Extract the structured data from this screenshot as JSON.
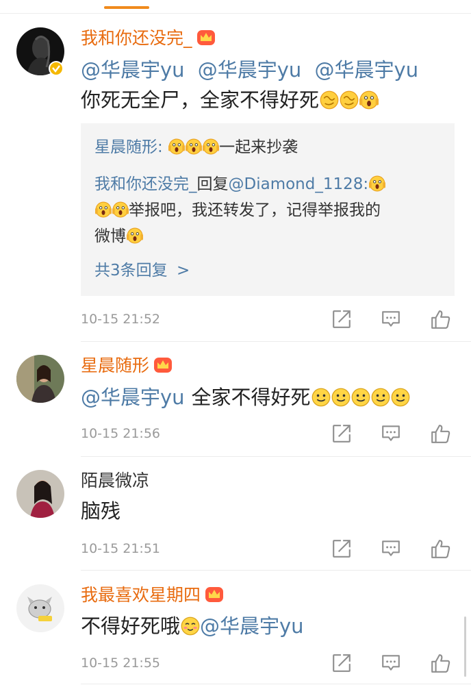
{
  "comments": [
    {
      "username": "我和你还没完_",
      "mentions": [
        "@华晨宇yu",
        "@华晨宇yu",
        "@华晨宇yu"
      ],
      "text": "你死无全尸，全家不得好死",
      "replies": {
        "r1_user": "星晨随形:",
        "r1_text": "一起来抄袭",
        "r2_user": "我和你还没完_",
        "r2_verb": "回复",
        "r2_mention": "@Diamond_1128:",
        "r2_text_a": "举报吧，我还转发了，记得举报我的",
        "r2_text_b": "微博",
        "more": "共3条回复",
        "more_chevron": ">"
      },
      "time": "10-15 21:52"
    },
    {
      "username": "星晨随形",
      "mention": "@华晨宇yu",
      "text": "全家不得好死",
      "time": "10-15 21:56"
    },
    {
      "username": "陌晨微凉",
      "text": "脑残",
      "time": "10-15 21:51"
    },
    {
      "username": "我最喜欢星期四",
      "text": "不得好死哦",
      "mention": "@华晨宇yu",
      "time": "10-15 21:55"
    }
  ],
  "icons": {
    "repost": "repost-icon",
    "comment": "comment-icon",
    "like": "like-icon",
    "crown": "vip-crown-icon",
    "verified": "verified-badge-icon"
  },
  "colors": {
    "username": "#e86b0f",
    "mention": "#4e7ba6",
    "timestamp": "#9a9a9a"
  }
}
